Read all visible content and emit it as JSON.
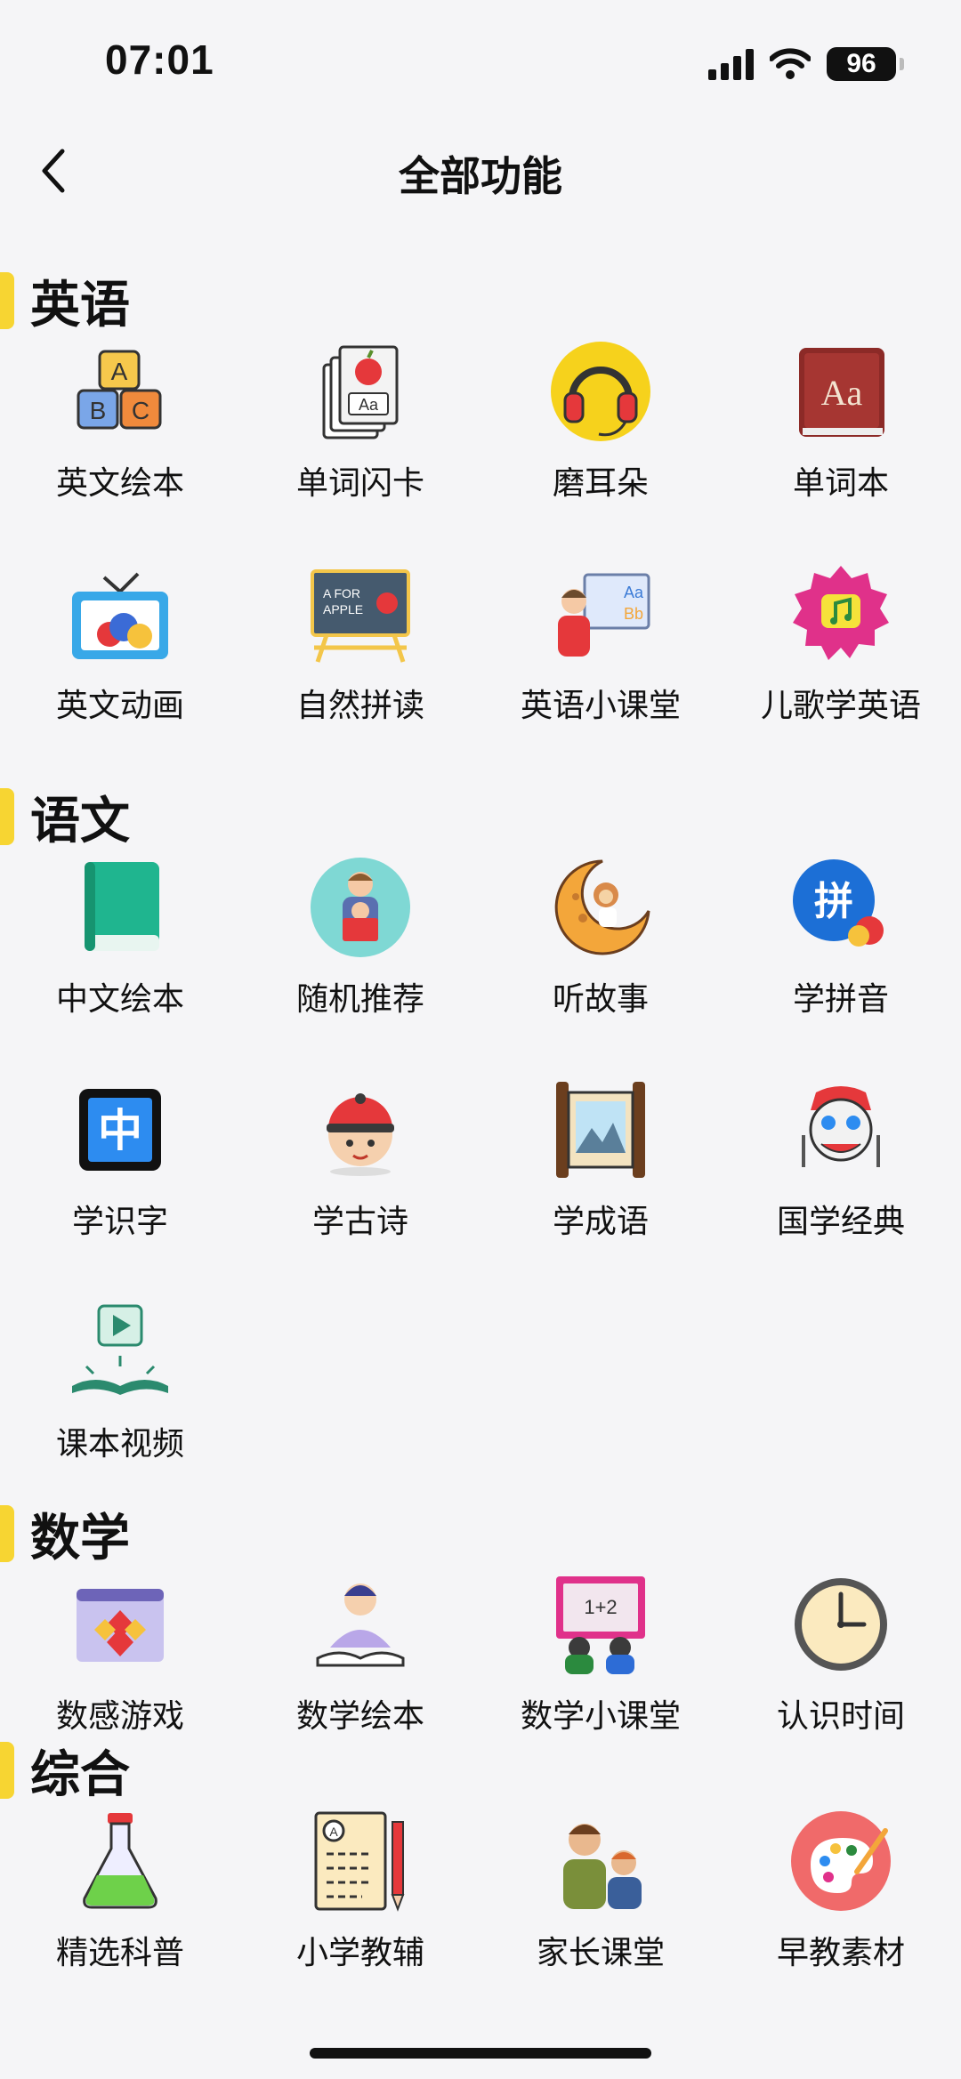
{
  "status": {
    "time": "07:01",
    "battery": "96"
  },
  "header": {
    "title": "全部功能",
    "back_icon": "chevron-left-icon"
  },
  "sections": [
    {
      "title": "英语",
      "items": [
        {
          "label": "英文绘本",
          "icon": "abc-blocks-icon"
        },
        {
          "label": "单词闪卡",
          "icon": "flashcards-icon"
        },
        {
          "label": "磨耳朵",
          "icon": "headphones-icon"
        },
        {
          "label": "单词本",
          "icon": "dictionary-icon"
        },
        {
          "label": "英文动画",
          "icon": "tv-icon"
        },
        {
          "label": "自然拼读",
          "icon": "easel-board-icon"
        },
        {
          "label": "英语小课堂",
          "icon": "teacher-board-icon"
        },
        {
          "label": "儿歌学英语",
          "icon": "music-badge-icon"
        }
      ]
    },
    {
      "title": "语文",
      "items": [
        {
          "label": "中文绘本",
          "icon": "green-book-icon"
        },
        {
          "label": "随机推荐",
          "icon": "parent-child-reading-icon"
        },
        {
          "label": "听故事",
          "icon": "moon-monkey-icon"
        },
        {
          "label": "学拼音",
          "icon": "pinyin-bubble-icon"
        },
        {
          "label": "学识字",
          "icon": "chinese-character-icon"
        },
        {
          "label": "学古诗",
          "icon": "boy-cap-icon"
        },
        {
          "label": "学成语",
          "icon": "scroll-painting-icon"
        },
        {
          "label": "国学经典",
          "icon": "lion-dance-icon"
        },
        {
          "label": "课本视频",
          "icon": "book-video-icon"
        }
      ]
    },
    {
      "title": "数学",
      "items": [
        {
          "label": "数感游戏",
          "icon": "number-game-icon"
        },
        {
          "label": "数学绘本",
          "icon": "reading-child-icon"
        },
        {
          "label": "数学小课堂",
          "icon": "math-class-icon"
        },
        {
          "label": "认识时间",
          "icon": "clock-icon"
        }
      ]
    },
    {
      "title": "综合",
      "items": [
        {
          "label": "精选科普",
          "icon": "flask-icon"
        },
        {
          "label": "小学教辅",
          "icon": "worksheet-icon"
        },
        {
          "label": "家长课堂",
          "icon": "parent-kid-icon"
        },
        {
          "label": "早教素材",
          "icon": "palette-icon"
        }
      ]
    }
  ]
}
